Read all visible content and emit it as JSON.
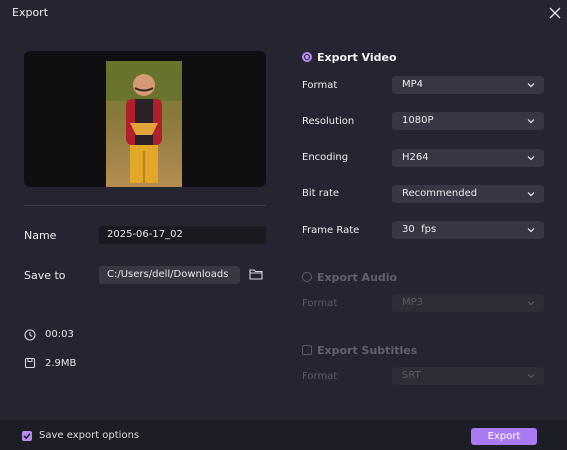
{
  "window": {
    "title": "Export"
  },
  "file": {
    "name_label": "Name",
    "name_value": "2025-06-17_02",
    "save_label": "Save to",
    "save_value": "C:/Users/dell/Downloads",
    "duration": "00:03",
    "size": "2.9MB"
  },
  "export_video": {
    "label": "Export Video",
    "selected": true,
    "fields": [
      {
        "label": "Format",
        "value": "MP4"
      },
      {
        "label": "Resolution",
        "value": "1080P"
      },
      {
        "label": "Encoding",
        "value": "H264"
      },
      {
        "label": "Bit rate",
        "value": "Recommended"
      },
      {
        "label": "Frame Rate",
        "value": "30  fps"
      }
    ]
  },
  "export_audio": {
    "label": "Export Audio",
    "selected": false,
    "format_label": "Format",
    "format_value": "MP3"
  },
  "export_subtitles": {
    "label": "Export Subtitles",
    "checked": false,
    "format_label": "Format",
    "format_value": "SRT"
  },
  "footer": {
    "save_options_label": "Save export options",
    "save_options_checked": true,
    "export_button": "Export"
  },
  "colors": {
    "accent": "#a97af0",
    "background": "#242530"
  },
  "icons": [
    "close-icon",
    "folder-icon",
    "clock-icon",
    "file-size-icon",
    "chevron-down-icon",
    "checkmark-icon"
  ]
}
